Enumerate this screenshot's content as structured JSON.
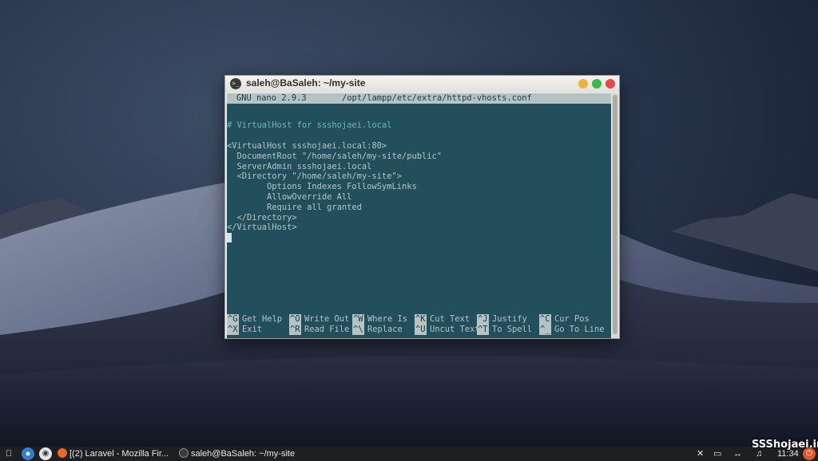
{
  "window": {
    "title": "saleh@BaSaleh: ~/my-site",
    "title_icon": ">_"
  },
  "nano": {
    "version": "GNU nano 2.9.3",
    "file": "/opt/lampp/etc/extra/httpd-vhosts.conf",
    "lines": [
      "# VirtualHost for ssshojaei.local",
      "",
      "<VirtualHost ssshojaei.local:80>",
      "  DocumentRoot \"/home/saleh/my-site/public\"",
      "  ServerAdmin ssshojaei.local",
      "  <Directory \"/home/saleh/my-site\">",
      "        Options Indexes FollowSymLinks",
      "        AllowOverride All",
      "        Require all granted",
      "  </Directory>",
      "</VirtualHost>"
    ],
    "shortcuts_row1": [
      {
        "key": "^G",
        "label": "Get Help"
      },
      {
        "key": "^O",
        "label": "Write Out"
      },
      {
        "key": "^W",
        "label": "Where Is"
      },
      {
        "key": "^K",
        "label": "Cut Text"
      },
      {
        "key": "^J",
        "label": "Justify"
      },
      {
        "key": "^C",
        "label": "Cur Pos"
      }
    ],
    "shortcuts_row2": [
      {
        "key": "^X",
        "label": "Exit"
      },
      {
        "key": "^R",
        "label": "Read File"
      },
      {
        "key": "^\\",
        "label": "Replace"
      },
      {
        "key": "^U",
        "label": "Uncut Text"
      },
      {
        "key": "^T",
        "label": "To Spell"
      },
      {
        "key": "^_",
        "label": "Go To Line"
      }
    ]
  },
  "taskbar": {
    "firefox_task": "[(2) Laravel - Mozilla Fir...",
    "terminal_task": "saleh@BaSaleh: ~/my-site",
    "clock": "11:34"
  },
  "watermark": "SSShojaei.ir",
  "colors": {
    "terminal_bg": "#0d3e4c",
    "comment": "#69b9bc",
    "close": "#e14d4d",
    "minimize": "#e8b43a",
    "maximize": "#3dbb4a"
  }
}
